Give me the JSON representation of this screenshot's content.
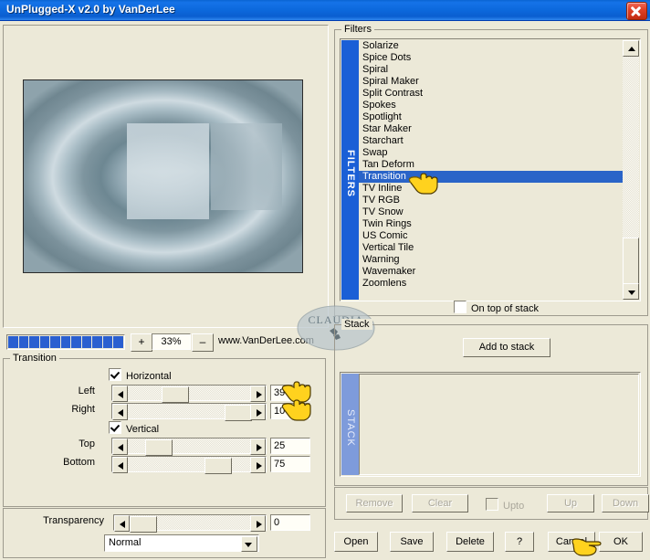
{
  "window": {
    "title": "UnPlugged-X v2.0 by VanDerLee",
    "close_label": "close-icon",
    "title_bg": "#0d6ade",
    "face": "#ece9d8"
  },
  "zoombar": {
    "plus_label": "+",
    "minus_label": "–",
    "zoom_value": "33%",
    "website": "www.VanDerLee.com",
    "blocks": 11,
    "block_color": "#2a5fd0"
  },
  "transition": {
    "title": "Transition",
    "horizontal": {
      "label": "Horizontal",
      "checked": true
    },
    "vertical": {
      "label": "Vertical",
      "checked": true
    },
    "sliders": [
      {
        "label": "Left",
        "value": "39",
        "percent": 39
      },
      {
        "label": "Right",
        "value": "100",
        "percent": 100
      },
      {
        "label": "Top",
        "value": "25",
        "percent": 25
      },
      {
        "label": "Bottom",
        "value": "75",
        "percent": 75
      }
    ],
    "transparency": {
      "label": "Transparency",
      "value": "0",
      "percent": 0
    },
    "blend_mode": {
      "selected": "Normal"
    }
  },
  "filters": {
    "title": "Filters",
    "vertical_label": "FILTERS",
    "selected": "Transition",
    "items": [
      "Solarize",
      "Spice Dots",
      "Spiral",
      "Spiral Maker",
      "Split Contrast",
      "Spokes",
      "Spotlight",
      "Star Maker",
      "Starchart",
      "Swap",
      "Tan Deform",
      "Transition",
      "TV Inline",
      "TV RGB",
      "TV Snow",
      "Twin Rings",
      "US Comic",
      "Vertical Tile",
      "Warning",
      "Wavemaker",
      "Zoomlens"
    ],
    "on_top_of_stack": {
      "label": "On top of stack",
      "checked": false
    },
    "selected_bg": "#2a64c8"
  },
  "stack": {
    "title": "Stack",
    "vertical_label": "STACK",
    "add_button": "Add to stack",
    "items": [],
    "controls": [
      {
        "label": "Remove",
        "enabled": false
      },
      {
        "label": "Clear",
        "enabled": false
      },
      {
        "label": "Up",
        "enabled": false
      },
      {
        "label": "Down",
        "enabled": false
      }
    ],
    "upto": {
      "label": "Upto",
      "checked": false,
      "enabled": false
    }
  },
  "footer": {
    "buttons": [
      {
        "label": "Open"
      },
      {
        "label": "Save"
      },
      {
        "label": "Delete"
      },
      {
        "label": "?"
      },
      {
        "label": "Cancel"
      },
      {
        "label": "OK"
      }
    ]
  },
  "watermark": {
    "text": "CLAUDIA"
  },
  "preview": {
    "description": "radial-blue-gradient-preview"
  }
}
